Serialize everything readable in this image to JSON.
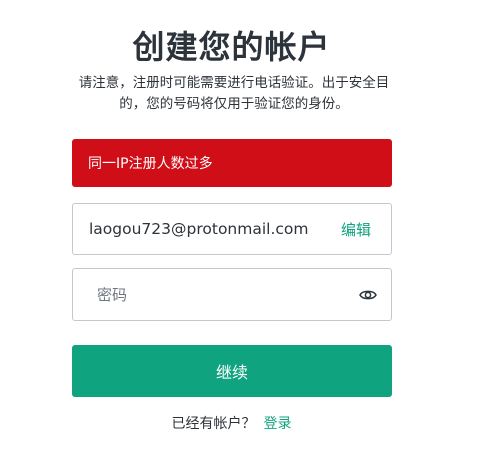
{
  "header": {
    "title": "创建您的帐户",
    "subtitle": "请注意，注册时可能需要进行电话验证。出于安全目的，您的号码将仅用于验证您的身份。"
  },
  "error": {
    "message": "同一IP注册人数过多",
    "color": "#d00e17"
  },
  "email": {
    "value": "laogou723@protonmail.com",
    "edit_label": "编辑"
  },
  "password": {
    "placeholder": "密码",
    "value": "",
    "toggle_icon": "eye-icon"
  },
  "continue_button": {
    "label": "继续"
  },
  "footer": {
    "prompt": "已经有帐户？",
    "login_label": "登录"
  },
  "colors": {
    "accent": "#10a37f",
    "text": "#2d333a",
    "border": "#c2c8d0"
  }
}
